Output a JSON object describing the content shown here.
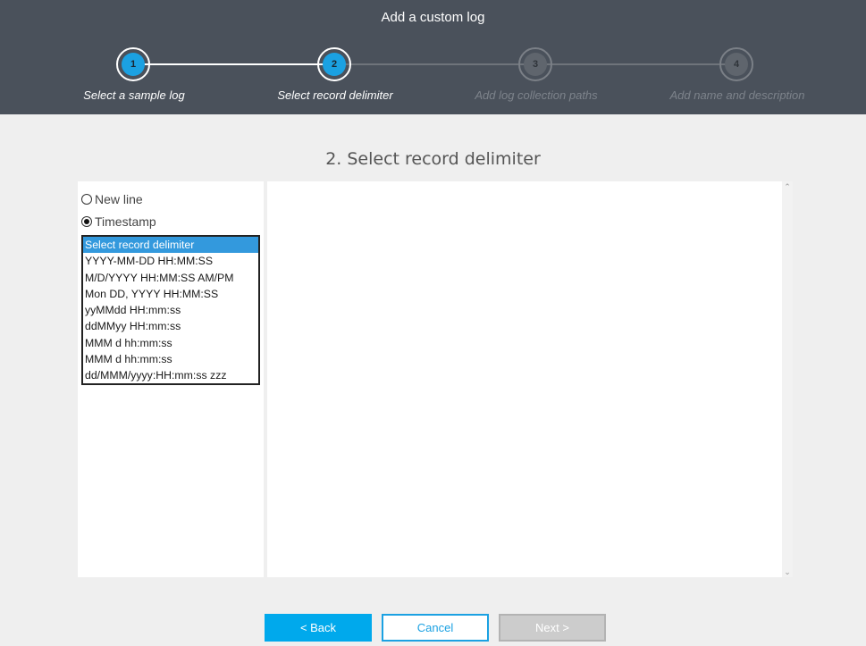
{
  "header": {
    "title": "Add a custom log",
    "steps": [
      {
        "number": "1",
        "label": "Select a sample log",
        "state": "active"
      },
      {
        "number": "2",
        "label": "Select record delimiter",
        "state": "active"
      },
      {
        "number": "3",
        "label": "Add log collection paths",
        "state": "inactive"
      },
      {
        "number": "4",
        "label": "Add name and description",
        "state": "inactive"
      }
    ]
  },
  "main": {
    "title": "2. Select record delimiter",
    "options": {
      "new_line_label": "New line",
      "timestamp_label": "Timestamp",
      "selected": "Timestamp"
    },
    "delimiters": [
      "Select record delimiter",
      "YYYY-MM-DD HH:MM:SS",
      "M/D/YYYY HH:MM:SS AM/PM",
      "Mon DD, YYYY HH:MM:SS",
      "yyMMdd HH:mm:ss",
      "ddMMyy HH:mm:ss",
      "MMM d hh:mm:ss",
      "MMM d hh:mm:ss",
      "dd/MMM/yyyy:HH:mm:ss zzz"
    ],
    "selected_delimiter_index": 0
  },
  "footer": {
    "back_label": "< Back",
    "cancel_label": "Cancel",
    "next_label": "Next >"
  },
  "colors": {
    "header_bg": "#4a515b",
    "accent": "#1ba1e2",
    "back_button": "#00a9ec",
    "disabled_button": "#cccccc"
  }
}
